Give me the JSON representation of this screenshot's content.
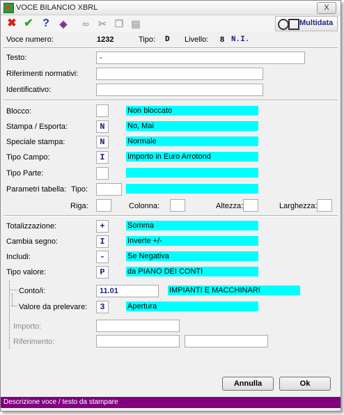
{
  "window": {
    "title": "VOCE BILANCIO XBRL",
    "close_glyph": "X"
  },
  "toolbar": {
    "icons": [
      "delete-icon",
      "confirm-icon",
      "help-icon",
      "edit-icon",
      "binoculars-icon",
      "cut-icon",
      "copy-icon",
      "paste-icon"
    ],
    "logo_text": "Multidata"
  },
  "header": {
    "voce_label": "Voce numero:",
    "voce_value": "1232",
    "tipo_label": "Tipo:",
    "tipo_value": "D",
    "livello_label": "Livello:",
    "livello_value": "8",
    "ni_value": "N.I."
  },
  "fields": {
    "testo_label": "Testo:",
    "testo_value": "-",
    "riferimenti_label": "Riferimenti normativi:",
    "riferimenti_value": "",
    "identificativo_label": "Identificativo:",
    "identificativo_value": ""
  },
  "blocco": {
    "label": "Blocco:",
    "code": "",
    "desc": "Non bloccato"
  },
  "stampa": {
    "label": "Stampa / Esporta:",
    "code": "N",
    "desc": "No, Mai"
  },
  "speciale": {
    "label": "Speciale stampa:",
    "code": "N",
    "desc": "Normale"
  },
  "tipo_campo": {
    "label": "Tipo Campo:",
    "code": "I",
    "desc": "Importo in Euro Arrotond"
  },
  "tipo_parte": {
    "label": "Tipo Parte:",
    "code": "",
    "desc": ""
  },
  "parametri": {
    "label": "Parametri tabella:",
    "tipo_label": "Tipo:",
    "tipo_value": "",
    "tipo_desc": "",
    "riga_label": "Riga:",
    "colonna_label": "Colonna:",
    "altezza_label": "Altezza:",
    "larghezza_label": "Larghezza:"
  },
  "totalizzazione": {
    "label": "Totalizzazione:",
    "code": "+",
    "desc": "Somma"
  },
  "cambia_segno": {
    "label": "Cambia segno:",
    "code": "I",
    "desc": "Inverte +/-"
  },
  "includi": {
    "label": "Includi:",
    "code": "-",
    "desc": "Se Negativa"
  },
  "tipo_valore": {
    "label": "Tipo valore:",
    "code": "P",
    "desc": "da PIANO DEI CONTI"
  },
  "conto": {
    "label": "Conto/i:",
    "value": "11.01",
    "desc": "IMPIANTI E MACCHINARI"
  },
  "valore_prelevare": {
    "label": "Valore da prelevare:",
    "code": "3",
    "desc": "Apertura"
  },
  "importo": {
    "label": "Importo:",
    "value": ""
  },
  "riferimento": {
    "label": "Riferimento:",
    "value1": "",
    "value2": ""
  },
  "buttons": {
    "annulla": "Annulla",
    "ok": "Ok"
  },
  "status": {
    "text": "Descrizione voce / testo da stampare"
  }
}
